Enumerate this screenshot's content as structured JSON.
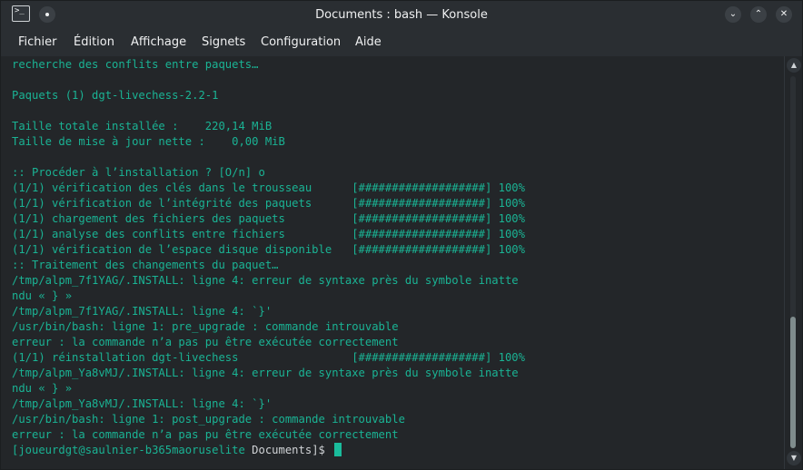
{
  "window": {
    "title": "Documents : bash — Konsole",
    "icons": {
      "app": "terminal-icon",
      "pin": "pin-icon",
      "minimize": "chevron-down-icon",
      "maximize": "chevron-up-icon",
      "close": "close-icon"
    },
    "controls": {
      "minimize_glyph": "⌄",
      "maximize_glyph": "⌃",
      "close_glyph": "✕"
    },
    "app_icon_glyph": ">_"
  },
  "menubar": {
    "items": [
      "Fichier",
      "Édition",
      "Affichage",
      "Signets",
      "Configuration",
      "Aide"
    ]
  },
  "terminal": {
    "lines": [
      "recherche des conflits entre paquets…",
      "",
      "Paquets (1) dgt-livechess-2.2-1",
      "",
      "Taille totale installée :    220,14 MiB",
      "Taille de mise à jour nette :    0,00 MiB",
      "",
      ":: Procéder à l’installation ? [O/n] o",
      "(1/1) vérification des clés dans le trousseau      [###################] 100%",
      "(1/1) vérification de l’intégrité des paquets      [###################] 100%",
      "(1/1) chargement des fichiers des paquets          [###################] 100%",
      "(1/1) analyse des conflits entre fichiers          [###################] 100%",
      "(1/1) vérification de l’espace disque disponible   [###################] 100%",
      ":: Traitement des changements du paquet…",
      "/tmp/alpm_7f1YAG/.INSTALL: ligne 4: erreur de syntaxe près du symbole inatte",
      "ndu « } »",
      "/tmp/alpm_7f1YAG/.INSTALL: ligne 4: `}'",
      "/usr/bin/bash: ligne 1: pre_upgrade : commande introuvable",
      "erreur : la commande n’a pas pu être exécutée correctement",
      "(1/1) réinstallation dgt-livechess                 [###################] 100%",
      "/tmp/alpm_Ya8vMJ/.INSTALL: ligne 4: erreur de syntaxe près du symbole inatte",
      "ndu « } »",
      "/tmp/alpm_Ya8vMJ/.INSTALL: ligne 4: `}'",
      "/usr/bin/bash: ligne 1: post_upgrade : commande introuvable",
      "erreur : la commande n’a pas pu être exécutée correctement"
    ],
    "prompt": {
      "user_host": "[joueurdgt@saulnier-b365maoruselite",
      "directory": "Documents",
      "suffix": "]$"
    },
    "colors": {
      "text": "#1ab394",
      "background": "#232629",
      "cursor": "#1abc9c"
    }
  },
  "scrollbar": {
    "up_glyph": "▲",
    "down_glyph": "▼",
    "position_fraction": 1.0,
    "visible_fraction": 0.35
  }
}
